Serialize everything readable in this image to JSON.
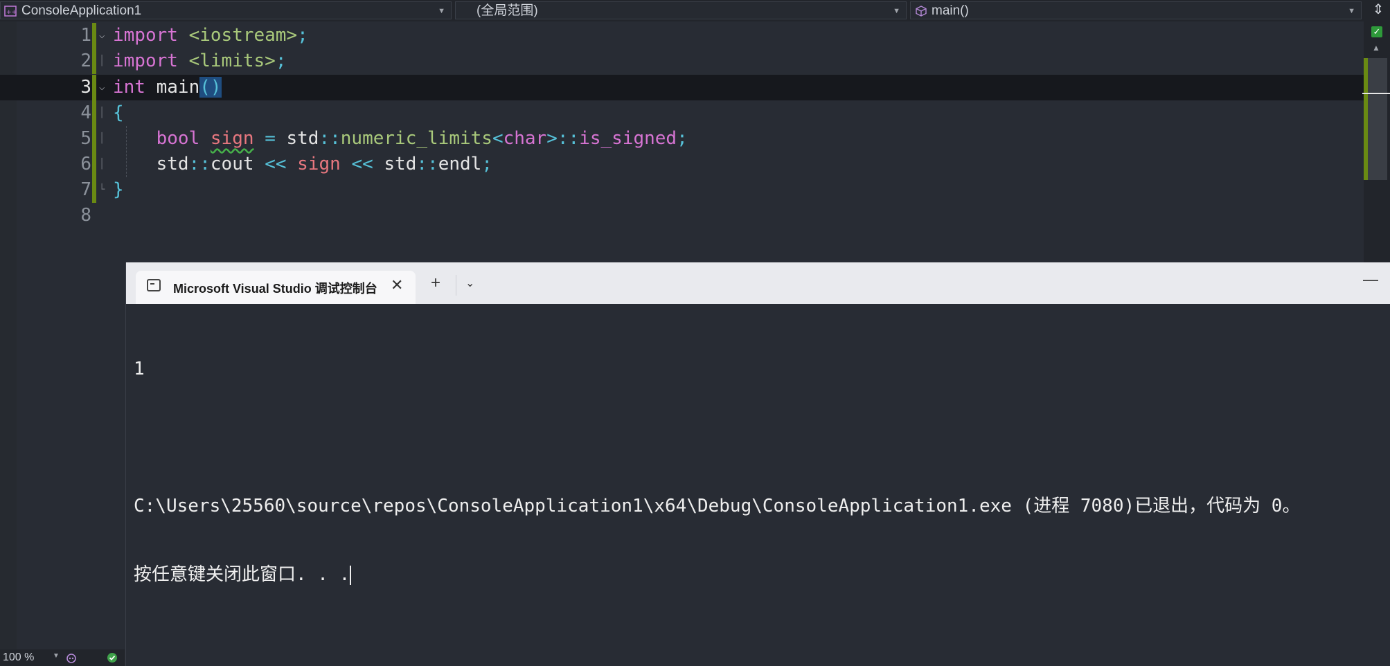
{
  "nav": {
    "project": "ConsoleApplication1",
    "scope": "(全局范围)",
    "member": "main()"
  },
  "editor": {
    "lines": [
      {
        "no": "1"
      },
      {
        "no": "2"
      },
      {
        "no": "3"
      },
      {
        "no": "4"
      },
      {
        "no": "5"
      },
      {
        "no": "6"
      },
      {
        "no": "7"
      },
      {
        "no": "8"
      }
    ],
    "tokens": {
      "import": "import",
      "iostream": "<iostream>",
      "limits": "<limits>",
      "semi": ";",
      "int": "int",
      "main": "main",
      "parens": "()",
      "lbrace": "{",
      "rbrace": "}",
      "bool": "bool",
      "sign": "sign",
      "eq": "=",
      "std": "std",
      "colons": "::",
      "numeric_limits": "numeric_limits",
      "lt": "<",
      "char": "char",
      "gt": ">",
      "is_signed": "is_signed",
      "cout": "cout",
      "shl": "<<",
      "endl": "endl"
    }
  },
  "status": {
    "zoom": "100 %"
  },
  "console": {
    "tab_title": "Microsoft Visual Studio 调试控制台",
    "output_lines": [
      "1",
      "",
      "C:\\Users\\25560\\source\\repos\\ConsoleApplication1\\x64\\Debug\\ConsoleApplication1.exe (进程 7080)已退出，代码为 0。",
      "按任意键关闭此窗口. . ."
    ]
  },
  "colors": {
    "editor_bg": "#282c34",
    "keyword": "#d774d3",
    "include": "#a9c97b",
    "punctuation": "#56c1d8",
    "variable": "#e8777f",
    "change_bar": "#6a8a13",
    "console_titlebar": "#e9eaee"
  }
}
